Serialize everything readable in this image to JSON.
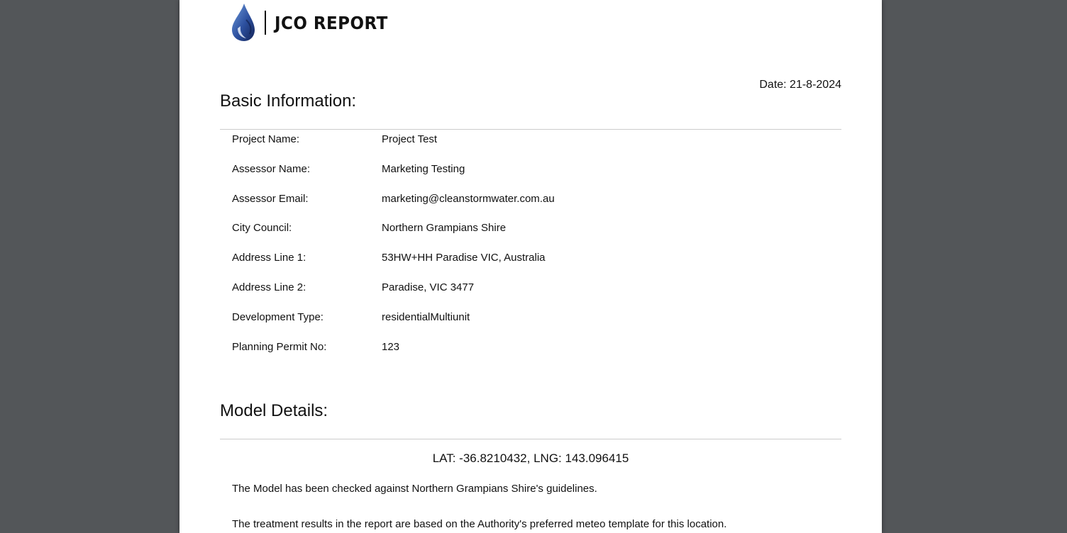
{
  "header": {
    "logo_text": "JCO REPORT",
    "date": "Date: 21-8-2024"
  },
  "basic_info": {
    "title": "Basic Information:",
    "rows": [
      {
        "label": "Project Name:",
        "value": "Project Test"
      },
      {
        "label": "Assessor Name:",
        "value": "Marketing Testing"
      },
      {
        "label": "Assessor Email:",
        "value": "marketing@cleanstormwater.com.au"
      },
      {
        "label": "City Council:",
        "value": "Northern Grampians Shire"
      },
      {
        "label": "Address Line 1:",
        "value": "53HW+HH Paradise VIC, Australia"
      },
      {
        "label": "Address Line 2:",
        "value": "Paradise, VIC 3477"
      },
      {
        "label": "Development Type:",
        "value": "residentialMultiunit"
      },
      {
        "label": "Planning Permit No:",
        "value": "123"
      }
    ]
  },
  "model_details": {
    "title": "Model Details:",
    "coordinates": "LAT: -36.8210432, LNG: 143.096415",
    "paragraphs": [
      "The Model has been checked against Northern Grampians Shire's guidelines.",
      "The treatment results in the report are based on the Authority's preferred meteo template for this location."
    ]
  },
  "colors": {
    "viewer_background": "#535659",
    "page_background": "#ffffff",
    "logo_drop_dark": "#1a2f6b",
    "logo_drop_light": "#4f7fc4",
    "divider": "#cccccc"
  },
  "icons": {
    "logo": "water-drop-icon"
  }
}
